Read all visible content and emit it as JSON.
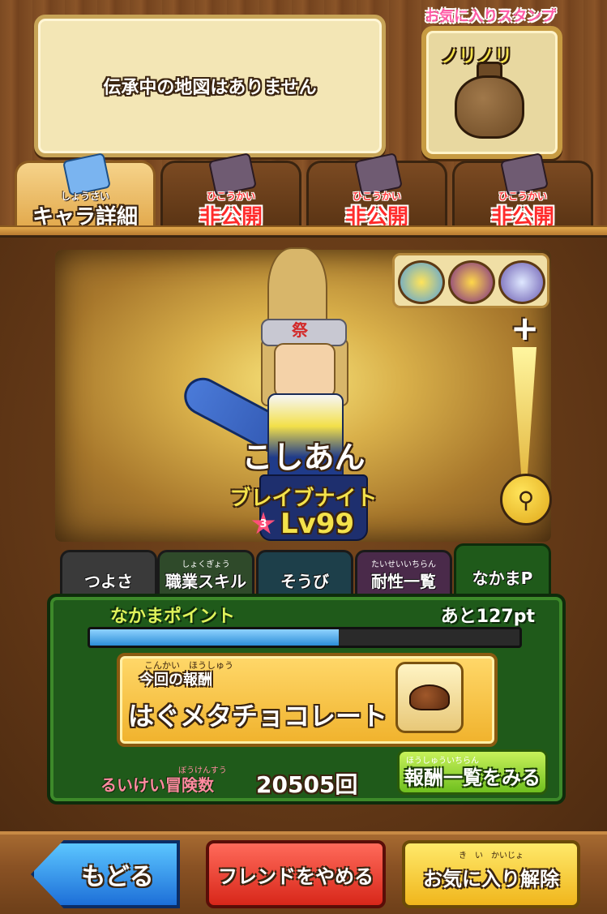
{
  "map_status": "伝承中の地図はありません",
  "favorite_stamp": {
    "label": "お気に入りスタンプ",
    "stamp_text": "ノリノリ"
  },
  "top_tabs": [
    {
      "ruby": "しょうさい",
      "label": "キャラ詳細",
      "icon": "map-scroll-icon",
      "active": true
    },
    {
      "ruby": "ひこうかい",
      "label": "非公開",
      "icon": "book-icon",
      "active": false
    },
    {
      "ruby": "ひこうかい",
      "label": "非公開",
      "icon": "crossed-swords-icon",
      "active": false
    },
    {
      "ruby": "ひこうかい",
      "label": "非公開",
      "icon": "smartphone-icon",
      "active": false
    }
  ],
  "character": {
    "name": "こしあん",
    "job": "ブレイブナイト",
    "star_rank": "3",
    "level_label": "Lv99",
    "headband_mark": "祭"
  },
  "zoom": {
    "plus_label": "+"
  },
  "sub_tabs": [
    {
      "label": "つよさ",
      "ruby": "",
      "color": "#3a3a3a"
    },
    {
      "label": "職業スキル",
      "ruby": "しょくぎょう",
      "color": "#2f4a2a"
    },
    {
      "label": "そうび",
      "ruby": "",
      "color": "#1d3f4a"
    },
    {
      "label": "耐性一覧",
      "ruby": "たいせいいちらん",
      "color": "#4a2a4a"
    },
    {
      "label": "なかまP",
      "ruby": "",
      "color": "#1f5a1a"
    }
  ],
  "nakama_points": {
    "label": "なかまポイント",
    "remaining": "あと127pt",
    "progress": 0.58
  },
  "reward": {
    "ruby": "こんかい　ほうしゅう",
    "label": "今回の報酬",
    "item_name": "はぐメタチョコレート",
    "list_button_ruby": "ほうしゅういちらん",
    "list_button": "報酬一覧をみる"
  },
  "adventures": {
    "ruby": "ぼうけんすう",
    "label": "るいけい冒険数",
    "count": "20505回"
  },
  "buttons": {
    "back": "もどる",
    "unfriend": "フレンドをやめる",
    "unfavorite_ruby": "き　い　かいじょ",
    "unfavorite": "お気に入り解除"
  }
}
